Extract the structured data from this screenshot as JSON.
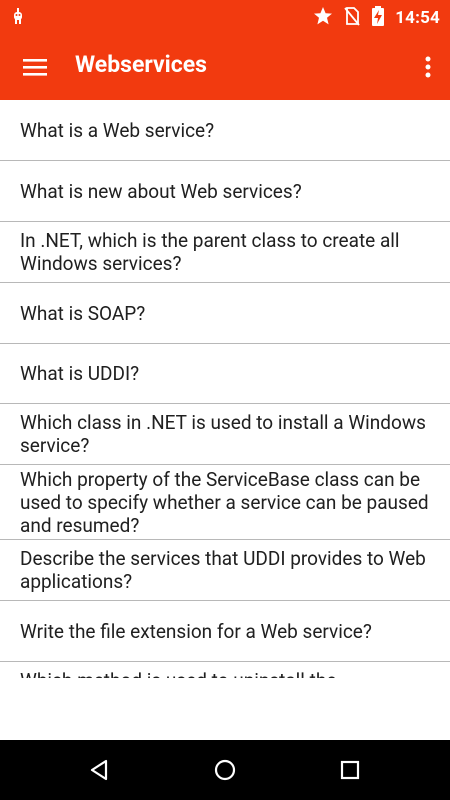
{
  "status_bar": {
    "time": "14:54",
    "icons": [
      "android-icon",
      "star-icon",
      "no-sim-icon",
      "battery-charging-icon"
    ]
  },
  "app_bar": {
    "title": "Webservices",
    "menu_icon": "hamburger-menu-icon",
    "more_icon": "more-vert-icon"
  },
  "questions": [
    "What is a Web service?",
    "What is new about Web services?",
    "In .NET, which is the parent class to create all Windows services?",
    "What is SOAP?",
    "What is UDDI?",
    "Which class in .NET is used to install a Windows service?",
    "Which property of the ServiceBase class can be used to specify whether a service can be paused and resumed?",
    "Describe the services that UDDI provides to Web applications?",
    "Write the file extension for a Web service?",
    "Which method is used to uninstall the"
  ],
  "nav_bar": {
    "icons": [
      "back-icon",
      "home-icon",
      "recents-icon"
    ]
  },
  "colors": {
    "primary": "#f23a0f",
    "text": "#202020",
    "divider": "#b8b8b8",
    "nav_bar": "#000000"
  }
}
